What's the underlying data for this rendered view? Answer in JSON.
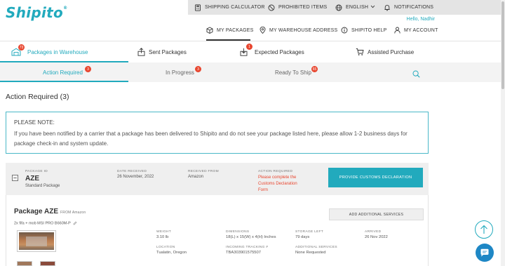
{
  "brand": {
    "logo_text": "Shipito",
    "logo_mark": "®"
  },
  "topbar": {
    "shipping_calculator": "SHIPPING CALCULATOR",
    "prohibited_items": "PROHIBITED ITEMS",
    "language": "ENGLISH",
    "notifications": "NOTIFICATIONS"
  },
  "user": {
    "greeting": "Hello, Nadhir"
  },
  "nav": {
    "my_packages": "MY PACKAGES",
    "warehouse_address": "MY WAREHOUSE ADDRESS",
    "help": "SHIPITO HELP",
    "my_account": "MY ACCOUNT"
  },
  "tabs": [
    {
      "label": "Packages in Warehouse",
      "badge": "73"
    },
    {
      "label": "Sent Packages",
      "badge": ""
    },
    {
      "label": "Expected Packages",
      "badge": "1"
    },
    {
      "label": "Assisted Purchase",
      "badge": ""
    }
  ],
  "subtabs": [
    {
      "label": "Action Required",
      "badge": "3"
    },
    {
      "label": "In Progress",
      "badge": "3"
    },
    {
      "label": "Ready To Ship",
      "badge": "65"
    }
  ],
  "section": {
    "title": "Action Required (3)"
  },
  "note": {
    "title": "PLEASE NOTE:",
    "body": "If you have been notified by a carrier that a package has been delivered to Shipito and do not see your package listed here, please allow 1-2 business days for package check-in and system update."
  },
  "package_header": {
    "id_label": "PACKAGE ID",
    "id_value": "AZE",
    "package_type": "Standard Package",
    "date_label": "DATE RECEIVED",
    "date_value": "26 November, 2022",
    "from_label": "RECEIVED FROM",
    "from_value": "Amazon",
    "action_label": "ACTION REQUIRED",
    "action_line1": "Please complete the",
    "action_line2": "Customs Declaration",
    "action_line3": "Form",
    "customs_button": "PROVIDE CUSTOMS DECLARATION"
  },
  "package_body": {
    "title": "Package AZE",
    "from": "FROM Amazon",
    "description": "2x fifa + mob MSI PRO B660M-P",
    "add_services": "ADD ADDITIONAL SERVICES",
    "weight_label": "WEIGHT",
    "weight_value": "3.10 lb",
    "dimensions_label": "DIMENSIONS",
    "dimensions_value": "18(L) x 15(W) x 4(H) Inches",
    "storage_label": "STORAGE LEFT",
    "storage_value": "79 days",
    "arrived_label": "ARRIVED",
    "arrived_value": "26 Nov 2022",
    "location_label": "LOCATION",
    "location_value": "Tualatin, Oregon",
    "tracking_label": "INCOMING TRACKING #",
    "tracking_value": "TBA303901575507",
    "services_label": "ADDITIONAL SERVICES",
    "services_value": "None Requested"
  },
  "colors": {
    "accent": "#22aabd",
    "badge": "#e8462f",
    "chat": "#1e87c5"
  }
}
